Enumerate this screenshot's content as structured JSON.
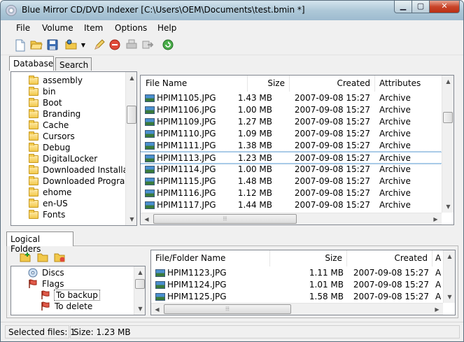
{
  "window": {
    "title": "Blue Mirror CD/DVD Indexer [C:\\Users\\OEM\\Documents\\test.bmin *]",
    "min_glyph": "▁",
    "max_glyph": "▢",
    "close_glyph": "✕"
  },
  "menu": [
    "File",
    "Volume",
    "Item",
    "Options",
    "Help"
  ],
  "toolbar": {
    "icons": [
      "new-file-icon",
      "open-folder-icon",
      "save-icon",
      "add-volume-icon",
      "edit-icon",
      "stop-icon",
      "print-icon",
      "export-icon",
      "refresh-icon"
    ]
  },
  "tabs": {
    "database": "Database",
    "search": "Search"
  },
  "tree": {
    "folders": [
      "assembly",
      "bin",
      "Boot",
      "Branding",
      "Cache",
      "Cursors",
      "Debug",
      "DigitalLocker",
      "Downloaded Installa",
      "Downloaded Prograr",
      "ehome",
      "en-US",
      "Fonts"
    ]
  },
  "file_table": {
    "columns": {
      "name": "File Name",
      "size": "Size",
      "created": "Created",
      "attributes": "Attributes"
    },
    "rows": [
      {
        "name": "HPIM1105.JPG",
        "size": "1.43 MB",
        "created": "2007-09-08 15:27",
        "attributes": "Archive"
      },
      {
        "name": "HPIM1106.JPG",
        "size": "1.00 MB",
        "created": "2007-09-08 15:27",
        "attributes": "Archive"
      },
      {
        "name": "HPIM1109.JPG",
        "size": "1.27 MB",
        "created": "2007-09-08 15:27",
        "attributes": "Archive"
      },
      {
        "name": "HPIM1110.JPG",
        "size": "1.09 MB",
        "created": "2007-09-08 15:27",
        "attributes": "Archive"
      },
      {
        "name": "HPIM1111.JPG",
        "size": "1.38 MB",
        "created": "2007-09-08 15:27",
        "attributes": "Archive"
      },
      {
        "name": "HPIM1113.JPG",
        "size": "1.23 MB",
        "created": "2007-09-08 15:27",
        "attributes": "Archive"
      },
      {
        "name": "HPIM1114.JPG",
        "size": "1.00 MB",
        "created": "2007-09-08 15:27",
        "attributes": "Archive"
      },
      {
        "name": "HPIM1115.JPG",
        "size": "1.48 MB",
        "created": "2007-09-08 15:27",
        "attributes": "Archive"
      },
      {
        "name": "HPIM1116.JPG",
        "size": "1.12 MB",
        "created": "2007-09-08 15:27",
        "attributes": "Archive"
      },
      {
        "name": "HPIM1117.JPG",
        "size": "1.44 MB",
        "created": "2007-09-08 15:27",
        "attributes": "Archive"
      }
    ],
    "selected_row": 5
  },
  "logical": {
    "tab": "Logical Folders",
    "tree": [
      {
        "label": "Discs",
        "icon": "disc-icon"
      },
      {
        "label": "Flags",
        "icon": "flag-icon"
      },
      {
        "label": "To backup",
        "icon": "flag-icon"
      },
      {
        "label": "To delete",
        "icon": "flag-icon"
      }
    ],
    "columns": {
      "name": "File/Folder Name",
      "size": "Size",
      "created": "Created",
      "attr": "A"
    },
    "rows": [
      {
        "name": "HPIM1123.JPG",
        "size": "1.11 MB",
        "created": "2007-09-08 15:27",
        "attr": "A"
      },
      {
        "name": "HPIM1124.JPG",
        "size": "1.01 MB",
        "created": "2007-09-08 15:27",
        "attr": "A"
      },
      {
        "name": "HPIM1125.JPG",
        "size": "1.58 MB",
        "created": "2007-09-08 15:27",
        "attr": "A"
      }
    ]
  },
  "status": {
    "selected": "Selected files: 1",
    "size": "Size: 1.23 MB"
  },
  "colors": {
    "accent": "#3399ff",
    "close_red": "#c9452a"
  }
}
